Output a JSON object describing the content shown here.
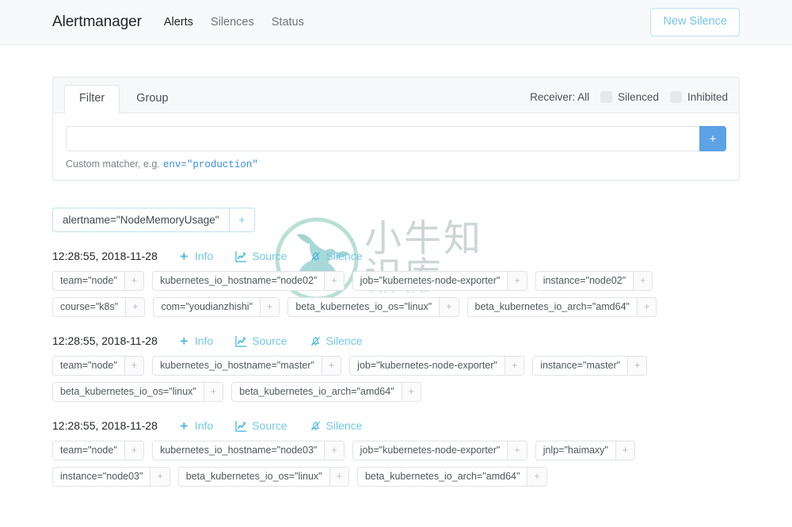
{
  "navbar": {
    "brand": "Alertmanager",
    "links": [
      {
        "label": "Alerts",
        "active": true
      },
      {
        "label": "Silences",
        "active": false
      },
      {
        "label": "Status",
        "active": false
      }
    ],
    "new_silence_label": "New Silence"
  },
  "filter_card": {
    "tabs": [
      {
        "label": "Filter",
        "active": true
      },
      {
        "label": "Group",
        "active": false
      }
    ],
    "receiver_label": "Receiver: All",
    "checkboxes": [
      {
        "label": "Silenced",
        "checked": false
      },
      {
        "label": "Inhibited",
        "checked": false
      }
    ],
    "matcher_input": {
      "value": "",
      "placeholder": ""
    },
    "add_button_label": "+",
    "help_text": "Custom matcher, e.g.",
    "help_code": "env=\"production\""
  },
  "active_filter": {
    "text": "alertname=\"NodeMemoryUsage\"",
    "plus_label": "+"
  },
  "actions": {
    "info": "Info",
    "source": "Source",
    "silence": "Silence"
  },
  "chip_plus": "+",
  "alerts": [
    {
      "timestamp": "12:28:55, 2018-11-28",
      "labels": [
        "team=\"node\"",
        "kubernetes_io_hostname=\"node02\"",
        "job=\"kubernetes-node-exporter\"",
        "instance=\"node02\"",
        "course=\"k8s\"",
        "com=\"youdianzhishi\"",
        "beta_kubernetes_io_os=\"linux\"",
        "beta_kubernetes_io_arch=\"amd64\""
      ]
    },
    {
      "timestamp": "12:28:55, 2018-11-28",
      "labels": [
        "team=\"node\"",
        "kubernetes_io_hostname=\"master\"",
        "job=\"kubernetes-node-exporter\"",
        "instance=\"master\"",
        "beta_kubernetes_io_os=\"linux\"",
        "beta_kubernetes_io_arch=\"amd64\""
      ]
    },
    {
      "timestamp": "12:28:55, 2018-11-28",
      "labels": [
        "team=\"node\"",
        "kubernetes_io_hostname=\"node03\"",
        "job=\"kubernetes-node-exporter\"",
        "jnlp=\"haimaxy\"",
        "instance=\"node03\"",
        "beta_kubernetes_io_os=\"linux\"",
        "beta_kubernetes_io_arch=\"amd64\""
      ]
    }
  ],
  "watermark": {
    "cn_text": "小牛知识库",
    "en_text": "XIAO NIU ZHI SHI KU"
  },
  "colors": {
    "accent_blue": "#5ca2e4",
    "link_blue": "#74c8e7",
    "watermark_teal": "#6ec6b6"
  }
}
